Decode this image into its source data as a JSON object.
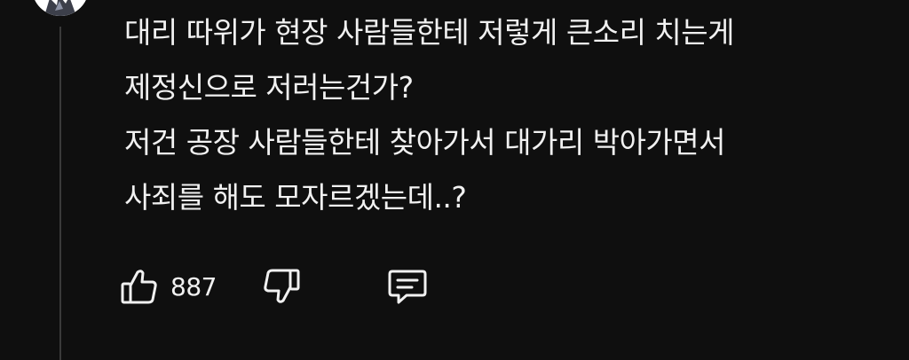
{
  "comment": {
    "lines": [
      "대리 따위가 현장 사람들한테 저렇게 큰소리 치는게",
      "제정신으로 저러는건가?",
      "저건 공장 사람들한테 찾아가서 대가리 박아가면서",
      "사죄를 해도 모자르겠는데..?"
    ]
  },
  "actions": {
    "like_count": "887",
    "like_icon": "thumbs-up-icon",
    "dislike_icon": "thumbs-down-icon",
    "reply_icon": "comment-reply-icon"
  },
  "colors": {
    "background": "#0f0f0f",
    "text": "#f1f1f1",
    "thread_line": "#3a3a3a"
  }
}
